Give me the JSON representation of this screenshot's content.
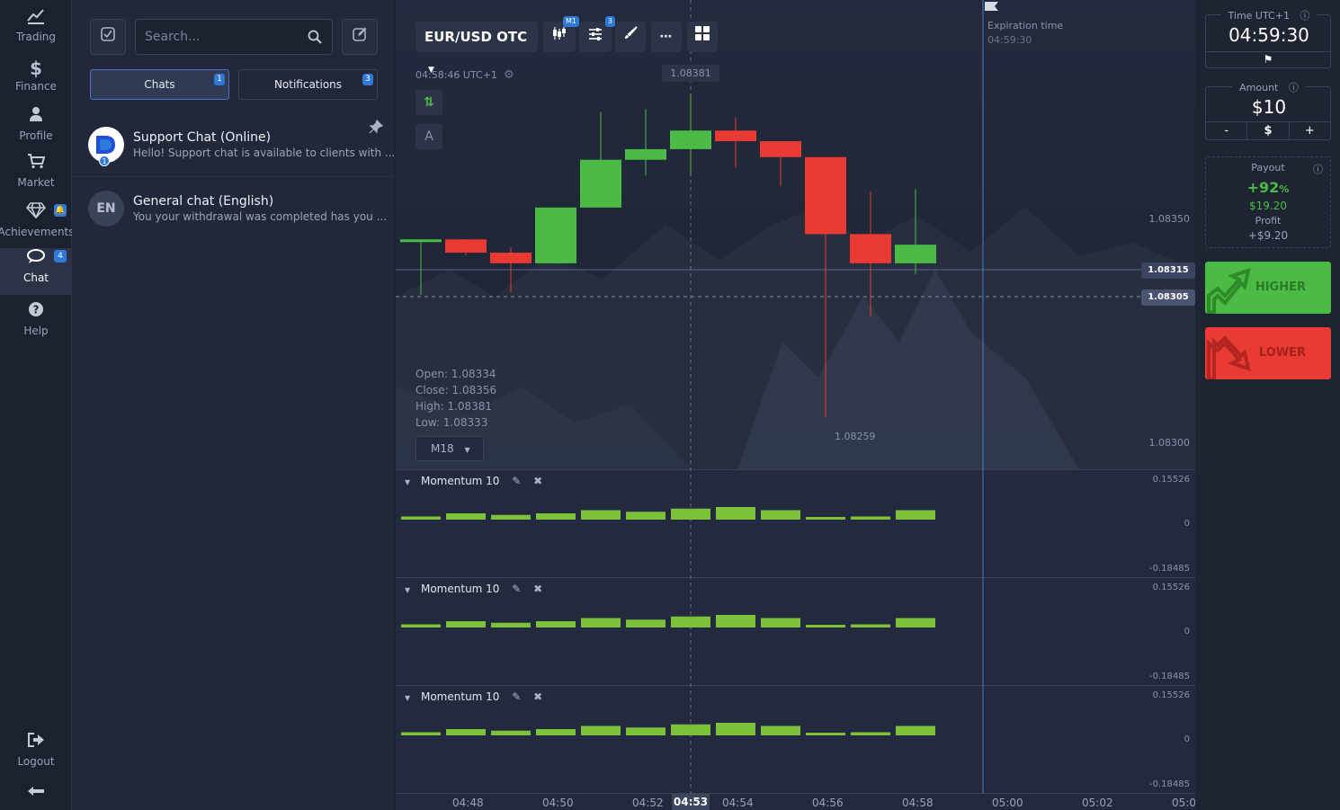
{
  "nav": {
    "items": [
      {
        "label": "Trading",
        "icon": "chart-line-icon"
      },
      {
        "label": "Finance",
        "icon": "dollar-icon"
      },
      {
        "label": "Profile",
        "icon": "user-icon"
      },
      {
        "label": "Market",
        "icon": "cart-icon"
      },
      {
        "label": "Achievements",
        "icon": "diamond-icon"
      },
      {
        "label": "Chat",
        "icon": "chat-icon",
        "badge": "4"
      },
      {
        "label": "Help",
        "icon": "help-icon"
      }
    ],
    "logout": "Logout"
  },
  "chat": {
    "search_placeholder": "Search...",
    "tabs": [
      {
        "label": "Chats",
        "badge": "1"
      },
      {
        "label": "Notifications",
        "badge": "3"
      }
    ],
    "items": [
      {
        "name": "Support Chat (Online)",
        "preview": "Hello! Support chat is available to clients with ...",
        "badge": "1"
      },
      {
        "name": "General chat (English)",
        "preview": "You your withdrawal was completed has you ...",
        "avatar": "EN"
      }
    ]
  },
  "chart": {
    "pair": "EUR/USD OTC",
    "timeframe_badge": "M1",
    "indicators_badge": "3",
    "server_time": "04:58:46 UTC+1",
    "hover_price": "1.08381",
    "low_price": "1.08259",
    "expiration_label": "Expiration time",
    "expiration_time": "04:59:30",
    "ohlc": {
      "open": "Open: 1.08334",
      "close": "Close: 1.08356",
      "high": "High: 1.08381",
      "low": "Low: 1.08333"
    },
    "period": "M18",
    "prices": {
      "p1": "1.08350",
      "current": "1.08315",
      "strike": "1.08305",
      "p2": "1.08300"
    },
    "indicators": [
      {
        "name": "Momentum 10",
        "max": "0.15526",
        "zero": "0",
        "min": "-0.18485"
      },
      {
        "name": "Momentum 10",
        "max": "0.15526",
        "zero": "0",
        "min": "-0.18485"
      },
      {
        "name": "Momentum 10",
        "max": "0.15526",
        "zero": "0",
        "min": "-0.18485"
      }
    ],
    "time_labels": [
      "04:48",
      "04:50",
      "04:52",
      "04:54",
      "04:56",
      "04:58",
      "05:00",
      "05:02",
      "05:04"
    ],
    "active_time": "04:53"
  },
  "chart_data": {
    "type": "candlestick",
    "x": [
      "04:47",
      "04:48",
      "04:49",
      "04:50",
      "04:51",
      "04:52",
      "04:53",
      "04:54",
      "04:55",
      "04:56",
      "04:57",
      "04:58"
    ],
    "open": [
      1.08326,
      1.08326,
      1.08321,
      1.08317,
      1.08338,
      1.08356,
      1.0836,
      1.08367,
      1.08363,
      1.08357,
      1.08328,
      1.08317
    ],
    "close": [
      1.08326,
      1.08321,
      1.08317,
      1.08338,
      1.08356,
      1.0836,
      1.08367,
      1.08363,
      1.08357,
      1.08328,
      1.08317,
      1.08324
    ],
    "high": [
      1.08326,
      1.08326,
      1.08323,
      1.08338,
      1.08374,
      1.08375,
      1.08381,
      1.08372,
      1.08357,
      1.08357,
      1.08344,
      1.08345
    ],
    "low": [
      1.08305,
      1.0832,
      1.08306,
      1.08317,
      1.08338,
      1.0835,
      1.0835,
      1.08353,
      1.08346,
      1.08259,
      1.08297,
      1.08313
    ],
    "momentum": [
      0.01,
      0.02,
      0.015,
      0.02,
      0.03,
      0.025,
      0.035,
      0.04,
      0.03,
      0.005,
      0.01,
      0.03
    ]
  },
  "trade": {
    "time_label": "Time UTC+1",
    "time_value": "04:59:30",
    "amount_label": "Amount",
    "amount_value": "$10",
    "amount_minus": "-",
    "amount_currency": "$",
    "amount_plus": "+",
    "payout_label": "Payout",
    "payout_pct": "+92",
    "payout_pct_sign": "%",
    "payout_amount": "$19.20",
    "profit_label": "Profit",
    "profit_value": "+$9.20",
    "higher": "HIGHER",
    "lower": "LOWER",
    "colors": {
      "higher": "#4cbb45",
      "lower": "#e93a33"
    }
  }
}
